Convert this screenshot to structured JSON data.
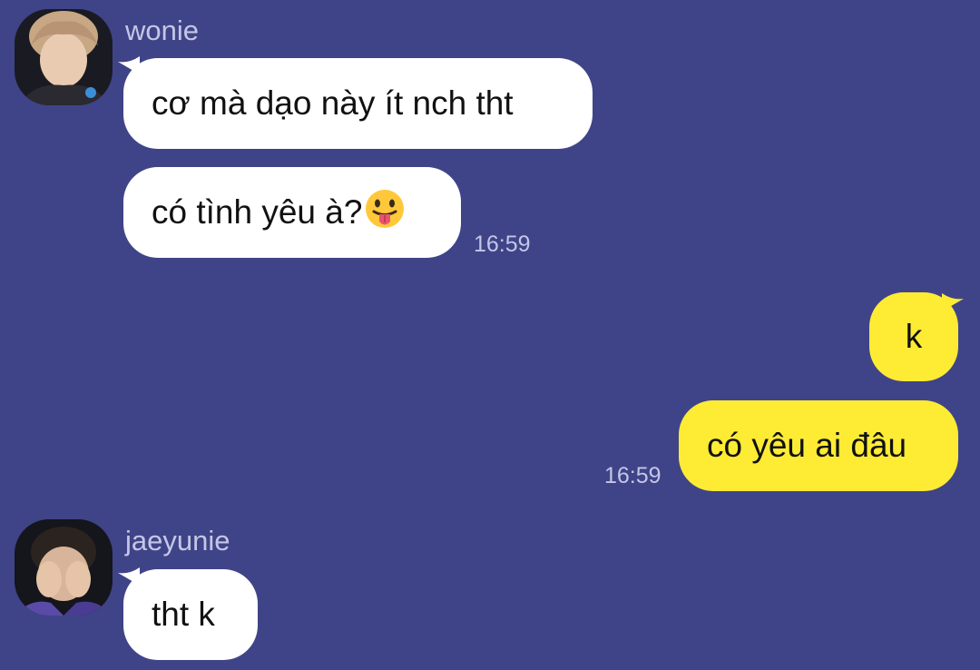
{
  "colors": {
    "background": "#3F4488",
    "incoming_bubble": "#FFFFFF",
    "outgoing_bubble": "#FEEB34",
    "meta_text": "#C4C6E6"
  },
  "messages": {
    "group1": {
      "sender": "wonie",
      "avatar": "wonie-avatar-photo",
      "bubble1": "cơ mà dạo này ít nch tht",
      "bubble2": "có tình yêu à?",
      "bubble2_emoji": "face-with-tongue-icon",
      "time": "16:59"
    },
    "group2": {
      "bubble1": "k",
      "bubble2": "có yêu ai đâu",
      "time": "16:59"
    },
    "group3": {
      "sender": "jaeyunie",
      "avatar": "jaeyunie-avatar-photo",
      "bubble1": "tht k"
    }
  }
}
